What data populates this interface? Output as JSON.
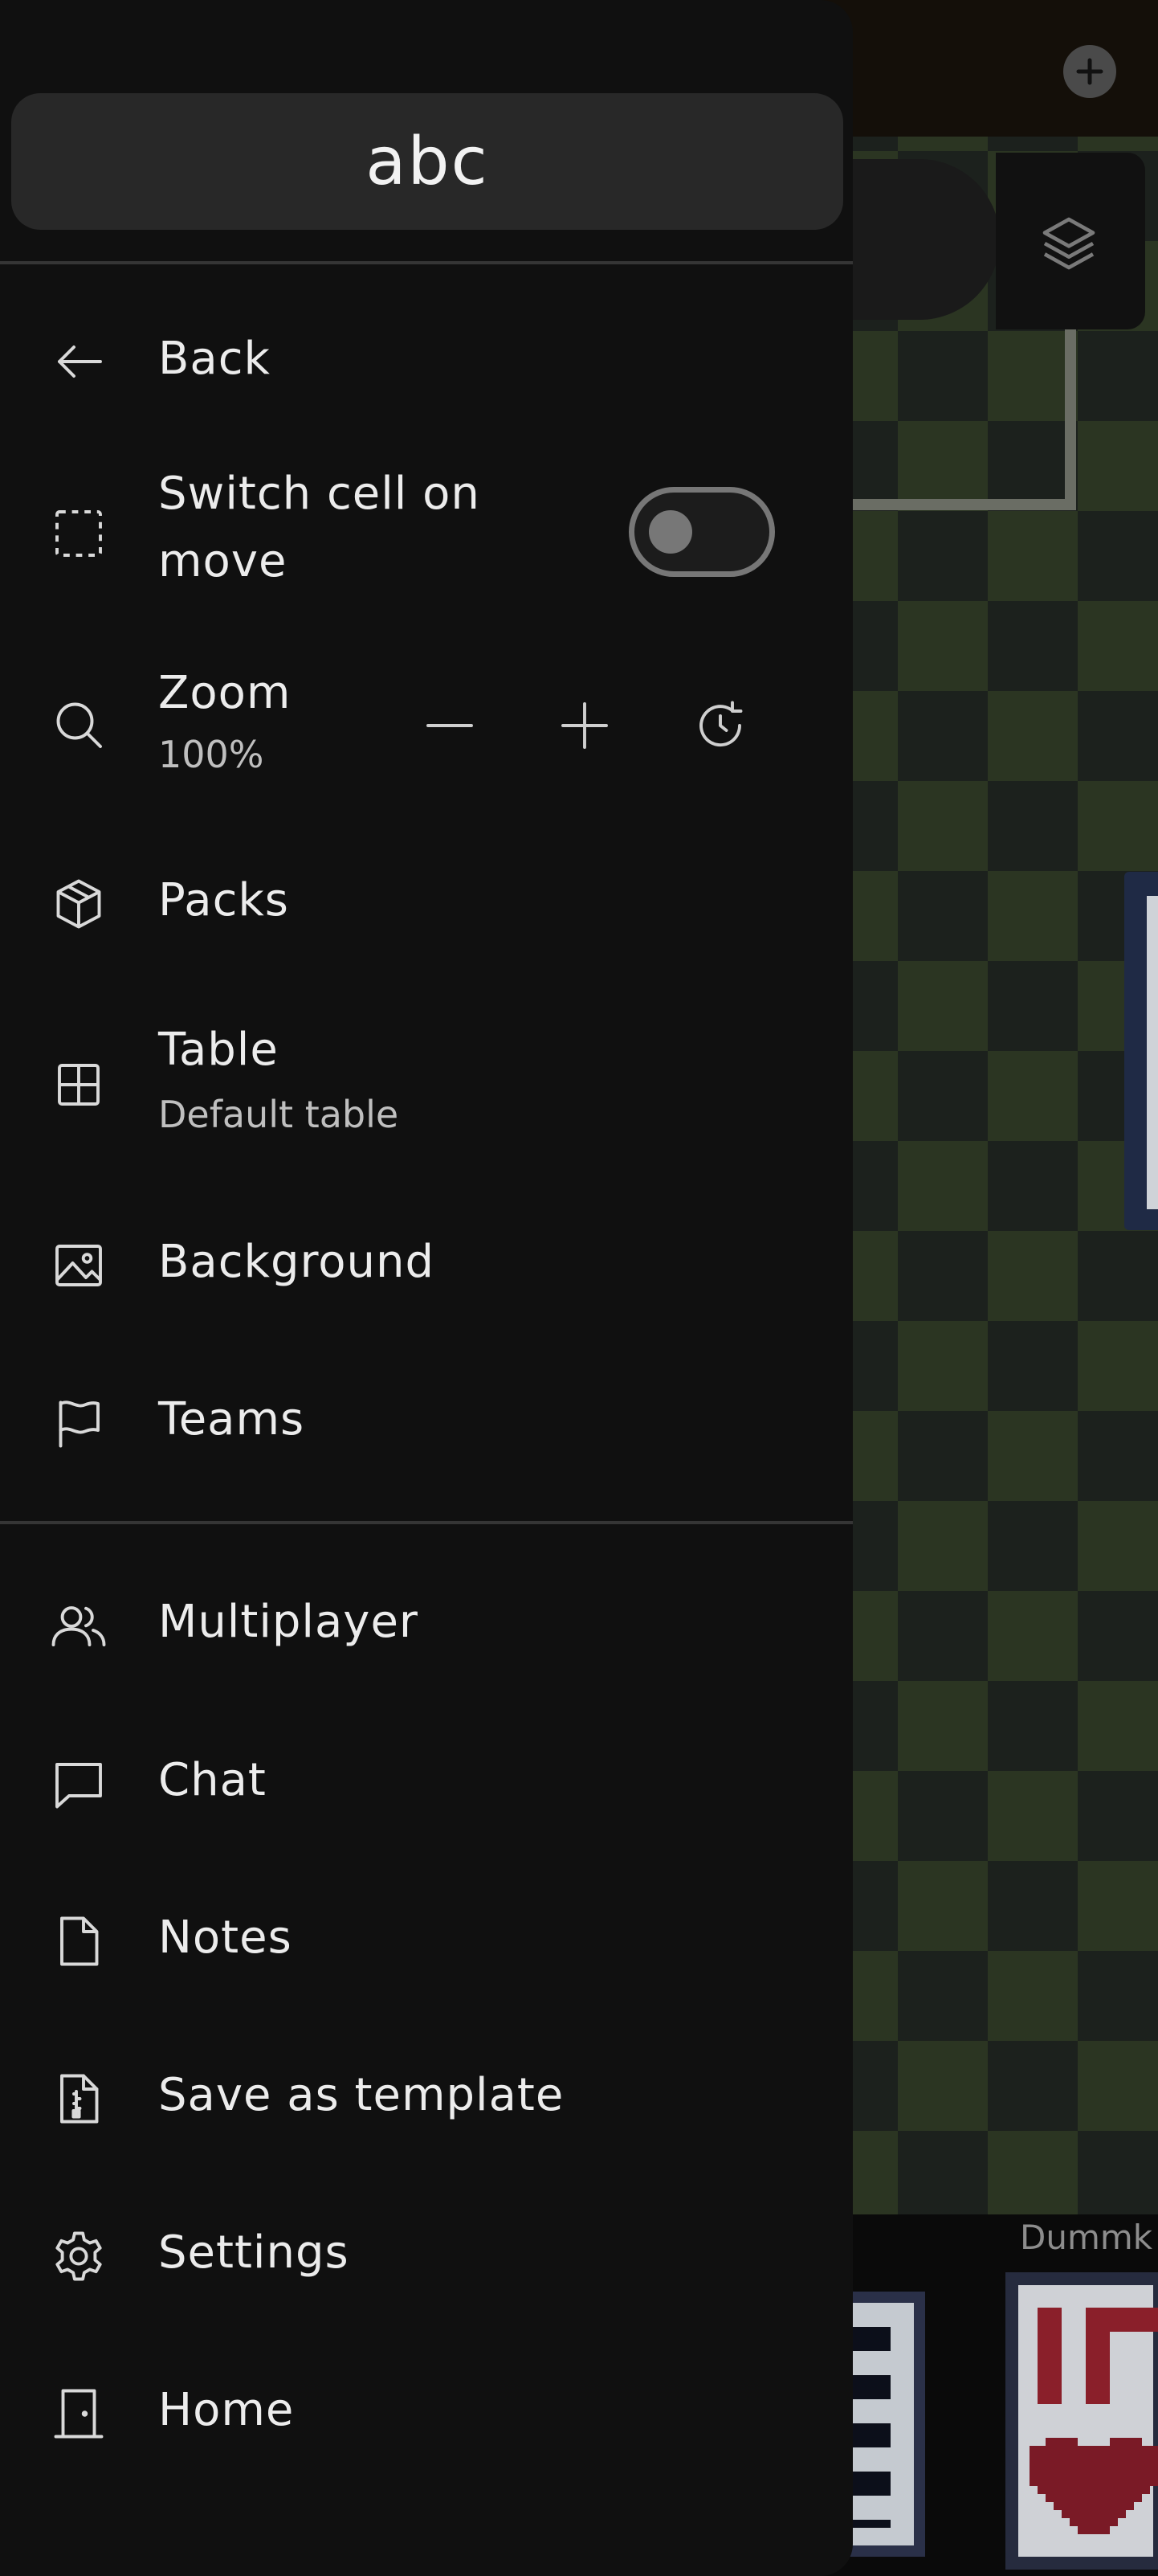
{
  "drawer": {
    "title": "abc",
    "items": {
      "back": {
        "label": "Back",
        "icon": "arrow-left-icon"
      },
      "switch_cell": {
        "label_line1": "Switch cell on",
        "label_line2": "move",
        "icon": "dashed-square-icon",
        "toggle_on": false
      },
      "zoom": {
        "label": "Zoom",
        "value": "100%",
        "icon": "search-icon"
      },
      "packs": {
        "label": "Packs",
        "icon": "box-icon"
      },
      "table": {
        "label": "Table",
        "sub": "Default table",
        "icon": "grid-icon"
      },
      "background": {
        "label": "Background",
        "icon": "image-icon"
      },
      "teams": {
        "label": "Teams",
        "icon": "flag-icon"
      },
      "multiplayer": {
        "label": "Multiplayer",
        "icon": "users-icon"
      },
      "chat": {
        "label": "Chat",
        "icon": "chat-bubble-icon"
      },
      "notes": {
        "label": "Notes",
        "icon": "document-icon"
      },
      "save_template": {
        "label": "Save as template",
        "icon": "file-zip-icon"
      },
      "settings": {
        "label": "Settings",
        "icon": "gear-icon"
      },
      "home": {
        "label": "Home",
        "icon": "door-icon"
      }
    }
  },
  "background": {
    "player_name": "Dummk"
  },
  "colors": {
    "drawer_bg": "#101010",
    "board_dark": "#1c211d",
    "board_light": "#2b3522",
    "card_red": "#8a1f2a"
  }
}
